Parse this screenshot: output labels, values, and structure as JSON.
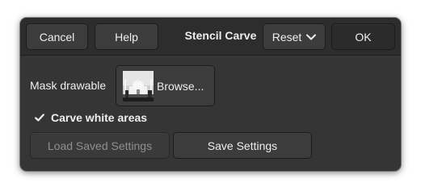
{
  "header": {
    "cancel_label": "Cancel",
    "help_label": "Help",
    "title": "Stencil Carve",
    "reset_label": "Reset",
    "ok_label": "OK"
  },
  "mask": {
    "label": "Mask drawable",
    "browse_label": "Browse..."
  },
  "options": {
    "carve_white_label": "Carve white areas",
    "carve_white_checked": true
  },
  "settings": {
    "load_label": "Load Saved Settings",
    "save_label": "Save Settings"
  },
  "icons": {
    "reset_chevron": "chevron-down-icon",
    "check": "check-icon",
    "thumbnail": "image-thumbnail-icon"
  },
  "colors": {
    "window_bg": "#353535",
    "header_bg": "#2d2d2d",
    "button_bg": "#3c3c3c",
    "text": "#eeeeec",
    "disabled_text": "#8f8f8d"
  }
}
